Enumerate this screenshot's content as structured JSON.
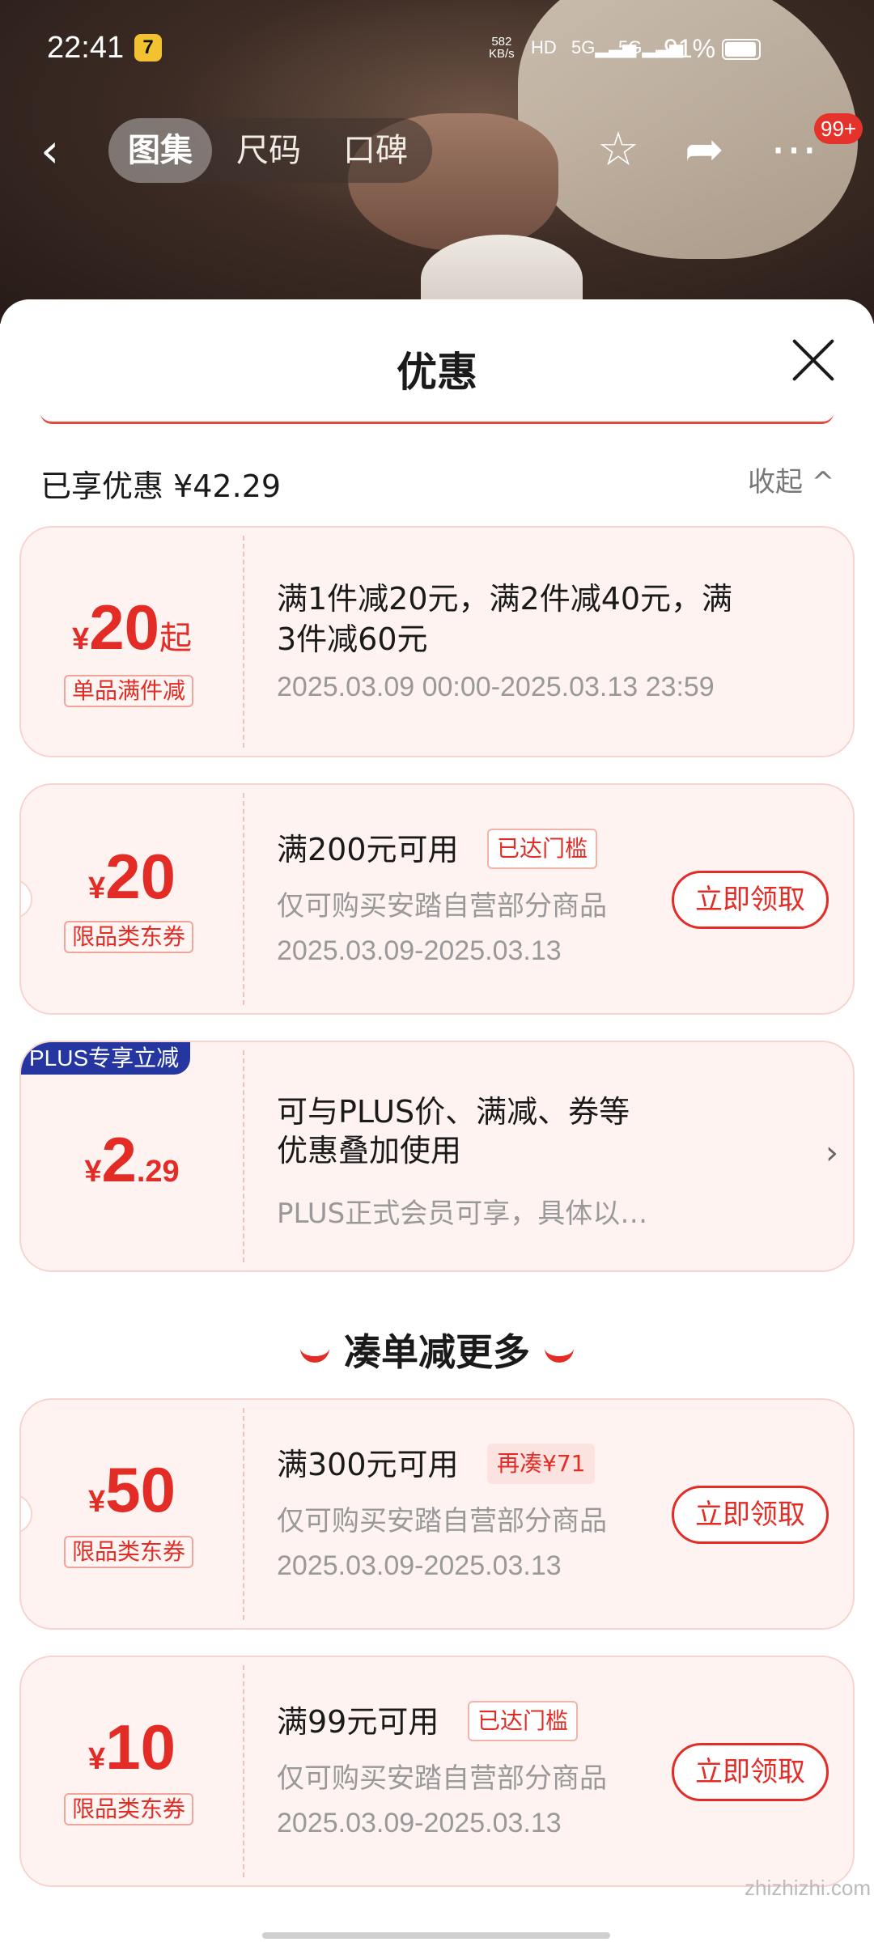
{
  "status_bar": {
    "time": "22:41",
    "app_badge": "7",
    "net_speed_value": "582",
    "net_speed_unit": "KB/s",
    "hd_label": "HD",
    "sig1_label": "5G",
    "sig2_label": "5G",
    "battery": "91%"
  },
  "nav": {
    "tabs": [
      "图集",
      "尺码",
      "口碑"
    ],
    "more_badge": "99+"
  },
  "sheet": {
    "title": "优惠",
    "enjoyed": "已享优惠 ¥42.29",
    "collapse": "收起 ^"
  },
  "coupons": [
    {
      "currency": "¥",
      "amount": "20",
      "suffix": "起",
      "tag": "单品满件减",
      "title_line1": "满1件减20元，满2件减40元，满",
      "title_line2": "3件减60元",
      "date": "2025.03.09 00:00-2025.03.13 23:59"
    },
    {
      "currency": "¥",
      "amount": "20",
      "tag": "限品类东券",
      "title": "满200元可用",
      "threshold": "已达门槛",
      "sub": "仅可购买安踏自营部分商品",
      "date": "2025.03.09-2025.03.13",
      "claim": "立即领取"
    },
    {
      "badge": "PLUS专享立减",
      "currency": "¥",
      "amount": "2",
      "decimal": ".29",
      "title_line1": "可与PLUS价、满减、券等",
      "title_line2": "优惠叠加使用",
      "sub": "PLUS正式会员可享，具体以…"
    }
  ],
  "section_more": "凑单减更多",
  "more_coupons": [
    {
      "currency": "¥",
      "amount": "50",
      "tag": "限品类东券",
      "title": "满300元可用",
      "threshold": "再凑¥71",
      "sub": "仅可购买安踏自营部分商品",
      "date": "2025.03.09-2025.03.13",
      "claim": "立即领取"
    },
    {
      "currency": "¥",
      "amount": "10",
      "tag": "限品类东券",
      "title": "满99元可用",
      "threshold": "已达门槛",
      "sub": "仅可购买安踏自营部分商品",
      "date": "2025.03.09-2025.03.13",
      "claim": "立即领取"
    }
  ],
  "watermark": "zhizhizhi.com",
  "colors": {
    "accent": "#e22c25",
    "card_bg": "#fff3f1",
    "plus_blue": "#2536a0"
  }
}
